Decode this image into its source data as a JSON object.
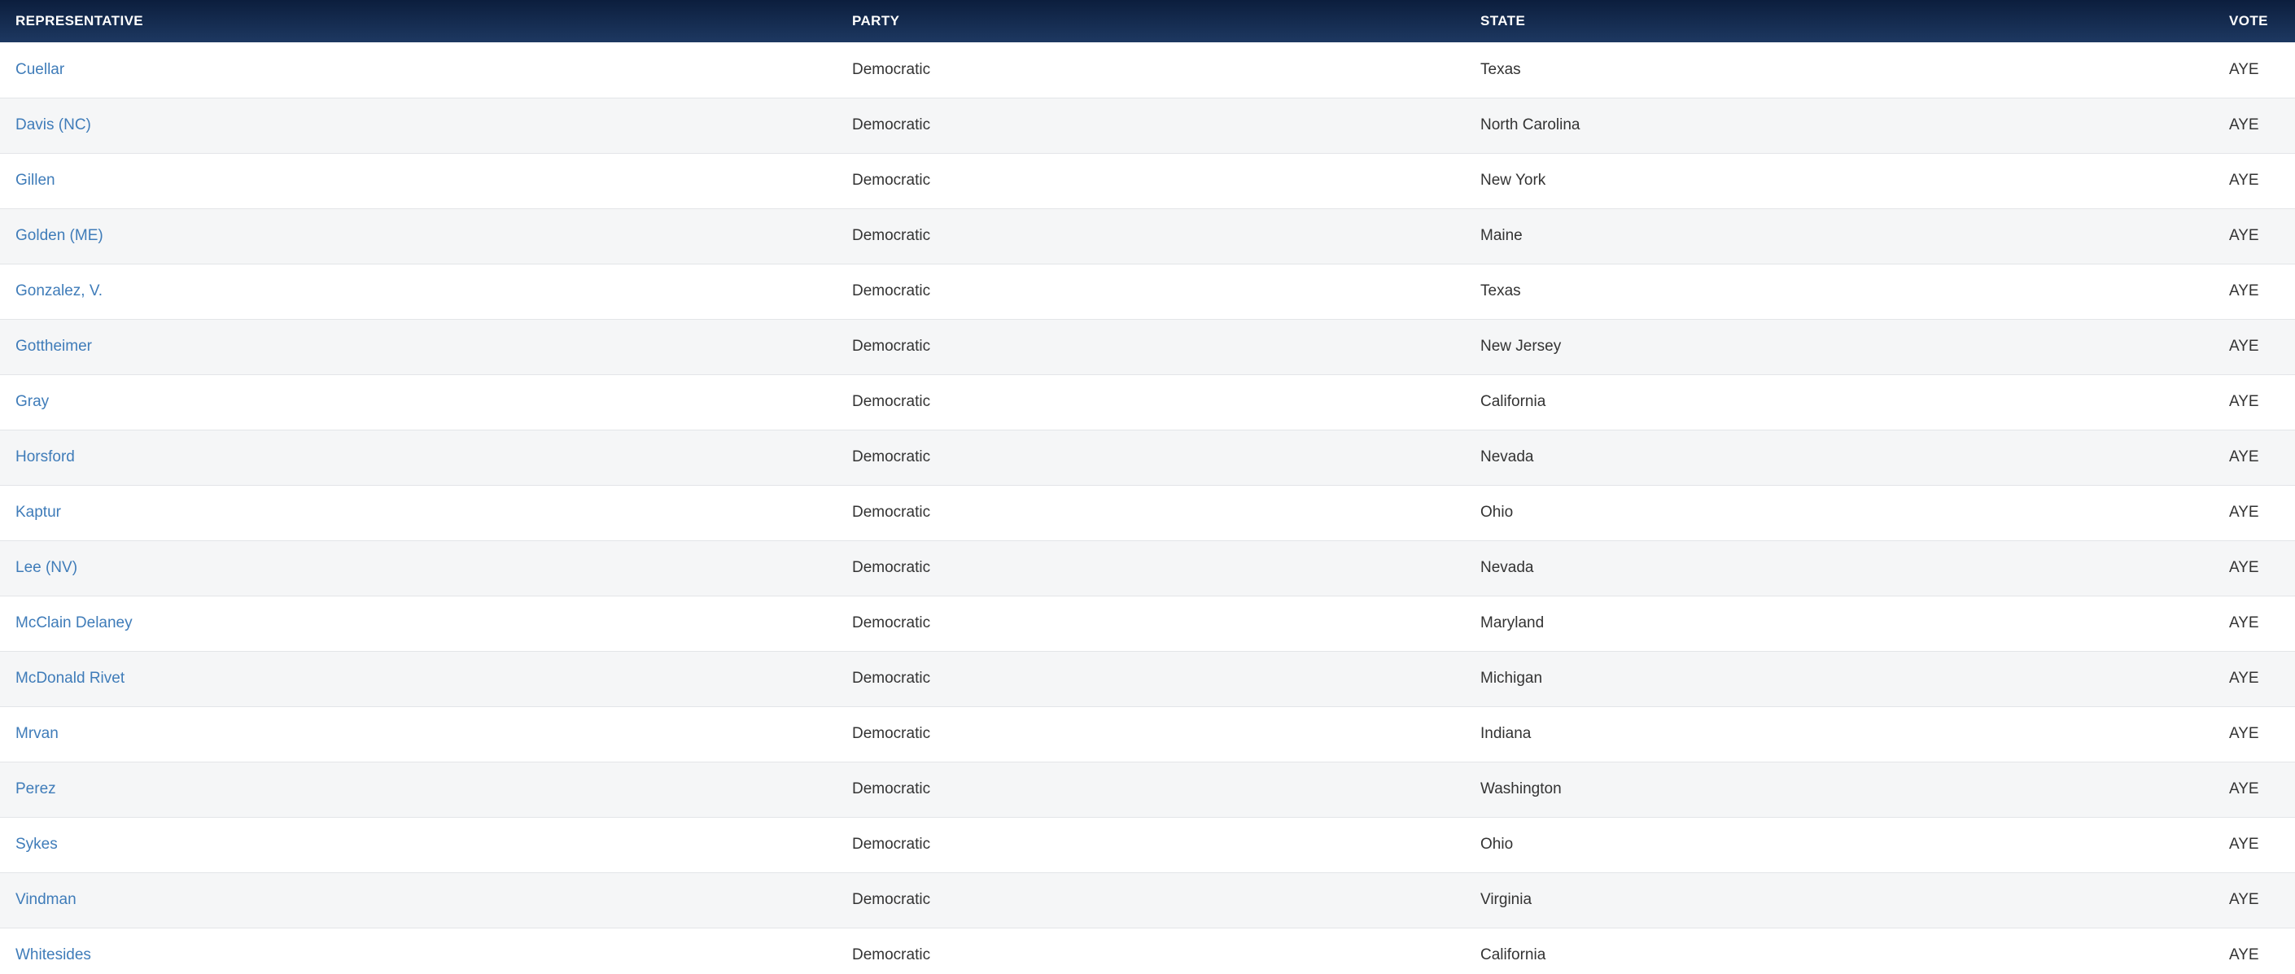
{
  "table": {
    "headers": {
      "representative": "REPRESENTATIVE",
      "party": "PARTY",
      "state": "STATE",
      "vote": "VOTE"
    },
    "rows": [
      {
        "name": "Cuellar",
        "party": "Democratic",
        "state": "Texas",
        "vote": "AYE"
      },
      {
        "name": "Davis (NC)",
        "party": "Democratic",
        "state": "North Carolina",
        "vote": "AYE"
      },
      {
        "name": "Gillen",
        "party": "Democratic",
        "state": "New York",
        "vote": "AYE"
      },
      {
        "name": "Golden (ME)",
        "party": "Democratic",
        "state": "Maine",
        "vote": "AYE"
      },
      {
        "name": "Gonzalez, V.",
        "party": "Democratic",
        "state": "Texas",
        "vote": "AYE"
      },
      {
        "name": "Gottheimer",
        "party": "Democratic",
        "state": "New Jersey",
        "vote": "AYE"
      },
      {
        "name": "Gray",
        "party": "Democratic",
        "state": "California",
        "vote": "AYE"
      },
      {
        "name": "Horsford",
        "party": "Democratic",
        "state": "Nevada",
        "vote": "AYE"
      },
      {
        "name": "Kaptur",
        "party": "Democratic",
        "state": "Ohio",
        "vote": "AYE"
      },
      {
        "name": "Lee (NV)",
        "party": "Democratic",
        "state": "Nevada",
        "vote": "AYE"
      },
      {
        "name": "McClain Delaney",
        "party": "Democratic",
        "state": "Maryland",
        "vote": "AYE"
      },
      {
        "name": "McDonald Rivet",
        "party": "Democratic",
        "state": "Michigan",
        "vote": "AYE"
      },
      {
        "name": "Mrvan",
        "party": "Democratic",
        "state": "Indiana",
        "vote": "AYE"
      },
      {
        "name": "Perez",
        "party": "Democratic",
        "state": "Washington",
        "vote": "AYE"
      },
      {
        "name": "Sykes",
        "party": "Democratic",
        "state": "Ohio",
        "vote": "AYE"
      },
      {
        "name": "Vindman",
        "party": "Democratic",
        "state": "Virginia",
        "vote": "AYE"
      },
      {
        "name": "Whitesides",
        "party": "Democratic",
        "state": "California",
        "vote": "AYE"
      }
    ]
  },
  "colors": {
    "header_dark": "#0c1e3d",
    "header_light": "#1d3861",
    "link": "#3f7cb9",
    "row_alt": "#f5f6f7"
  }
}
